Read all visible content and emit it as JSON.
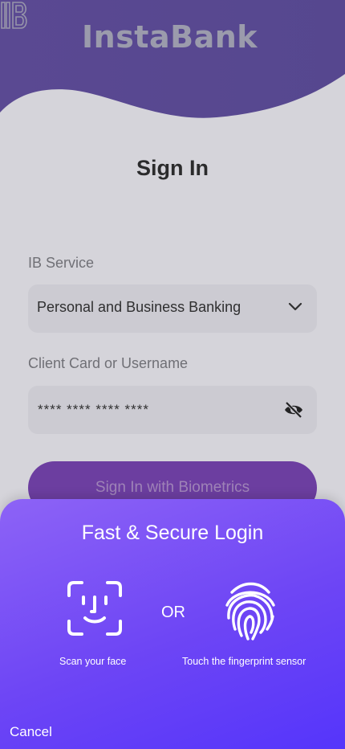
{
  "brand": {
    "name": "InstaBank",
    "logo_text": "IB",
    "logo_icon": "ib-monogram-icon"
  },
  "signin": {
    "title": "Sign In",
    "service_label": "IB Service",
    "service_value": "Personal and Business Banking",
    "card_label": "Client Card or Username",
    "card_value": "**** **** **** ****",
    "biometrics_button": "Sign In with Biometrics"
  },
  "sheet": {
    "title": "Fast & Secure Login",
    "face_caption": "Scan your face",
    "or_text": "OR",
    "finger_caption": "Touch the fingerprint sensor",
    "cancel": "Cancel",
    "face_icon": "face-scan-icon",
    "finger_icon": "fingerprint-icon"
  },
  "colors": {
    "header": "#4c3d8f",
    "button": "#6a31a8",
    "sheet_start": "#8d63f6",
    "sheet_end": "#5535fb"
  }
}
